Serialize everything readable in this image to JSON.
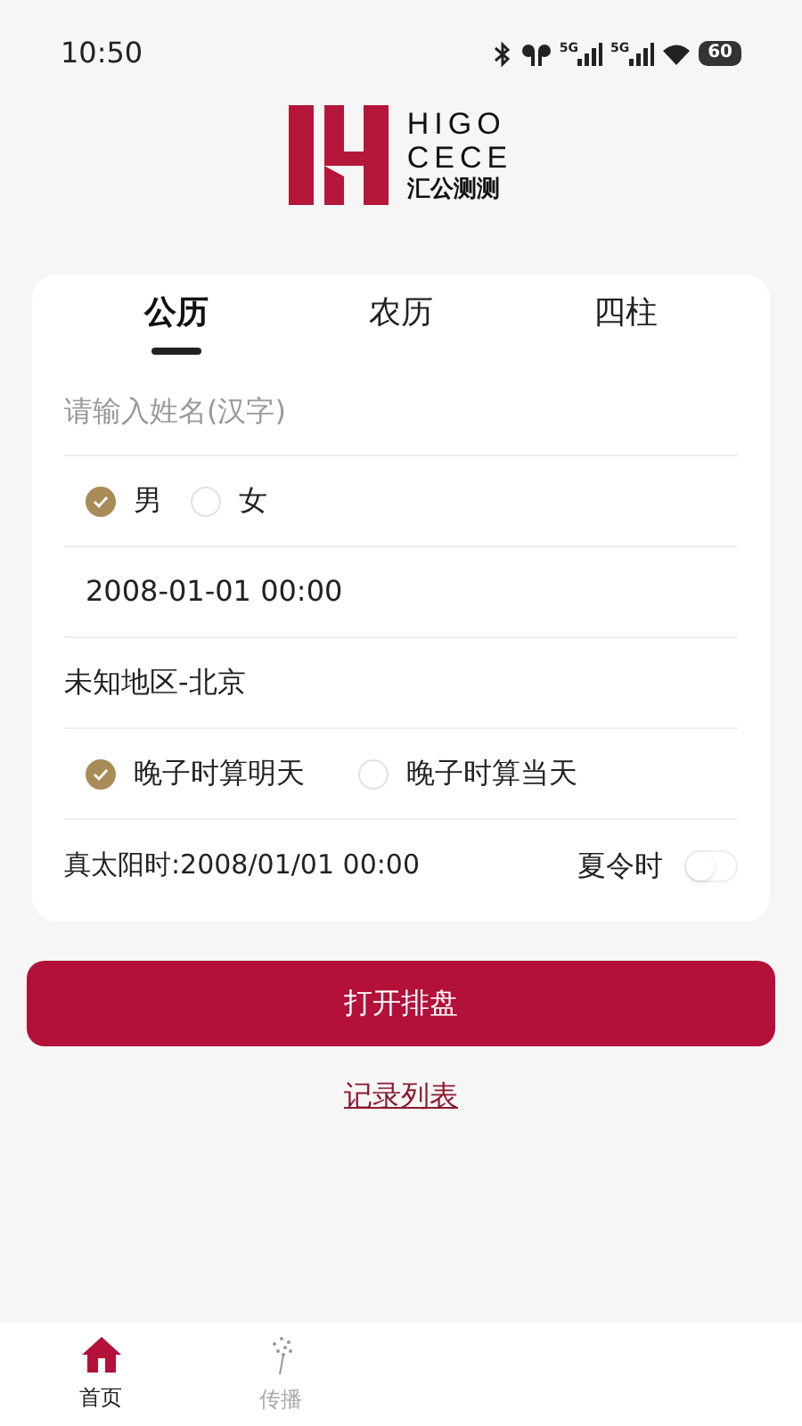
{
  "status_bar": {
    "time": "10:50",
    "network_labels": [
      "5G",
      "5G"
    ],
    "battery": "60"
  },
  "logo": {
    "line_1": "HIGO",
    "line_2": "CECE",
    "line_3": "汇公测测"
  },
  "tabs": [
    {
      "label": "公历",
      "selected": true
    },
    {
      "label": "农历",
      "selected": false
    },
    {
      "label": "四柱",
      "selected": false
    }
  ],
  "form": {
    "name_field": {
      "placeholder": "请输入姓名(汉字)"
    },
    "gender": [
      {
        "label": "男",
        "selected": true
      },
      {
        "label": "女",
        "selected": false
      }
    ],
    "datetime": "2008-01-01 00:00",
    "location": "未知地区-北京",
    "night_zi": [
      {
        "label": "晚子时算明天",
        "selected": true
      },
      {
        "label": "晚子时算当天",
        "selected": false
      }
    ],
    "true_solar_time": "真太阳时:2008/01/01 00:00",
    "dst": {
      "label": "夏令时",
      "on": false
    }
  },
  "primary_button": "打开排盘",
  "records_link": "记录列表",
  "bottom_nav": [
    {
      "label": "首页",
      "kind": "home",
      "selected": true
    },
    {
      "label": "传播",
      "kind": "spread",
      "selected": false
    }
  ]
}
